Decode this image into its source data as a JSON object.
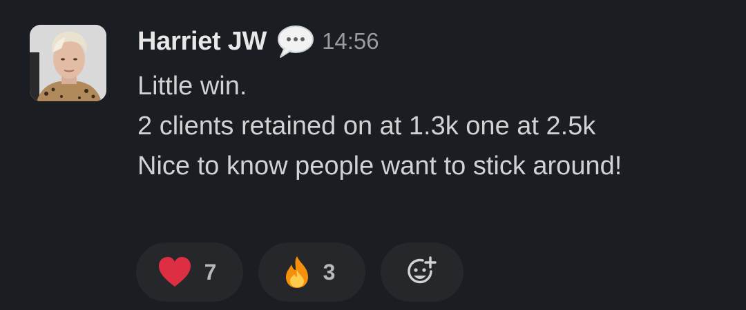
{
  "message": {
    "author": "Harriet JW",
    "timestamp": "14:56",
    "status_icon": "speech-bubble-icon",
    "lines": [
      "Little win.",
      "2 clients retained on at 1.3k one at 2.5k",
      "Nice to know people want to stick around!"
    ]
  },
  "reactions": [
    {
      "emoji": "heart-icon",
      "count": "7"
    },
    {
      "emoji": "fire-icon",
      "count": "3"
    }
  ],
  "add_reaction": {
    "icon": "add-emoji-icon"
  },
  "colors": {
    "background": "#1a1d21",
    "pill": "#25272b",
    "heart": "#dd2e44",
    "fire": "#f4900c"
  }
}
